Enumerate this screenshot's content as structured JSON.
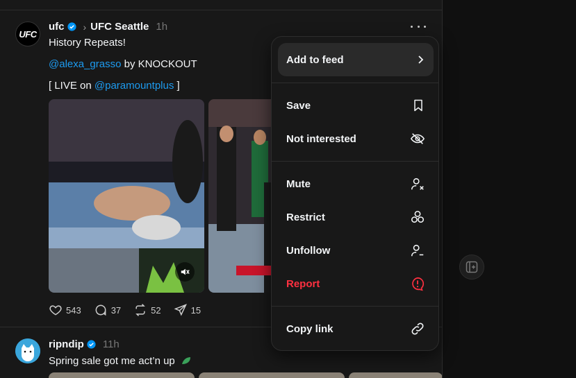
{
  "post1": {
    "avatar_text": "UFC",
    "username": "ufc",
    "community": "UFC Seattle",
    "time": "1h",
    "line1": "History Repeats!",
    "mention1": "@alexa_grasso",
    "line2_rest": " by KNOCKOUT",
    "line3_start": "[ LIVE on ",
    "mention2": "@paramountplus",
    "line3_end": " ]",
    "likes": "543",
    "comments": "37",
    "reposts": "52",
    "shares": "15"
  },
  "post2": {
    "username": "ripndip",
    "time": "11h",
    "text": "Spring sale got me act’n up"
  },
  "menu": {
    "add_to_feed": "Add to feed",
    "save": "Save",
    "not_interested": "Not interested",
    "mute": "Mute",
    "restrict": "Restrict",
    "unfollow": "Unfollow",
    "report": "Report",
    "copy_link": "Copy link"
  },
  "colors": {
    "mention": "#1d9bf0",
    "danger": "#ff3040",
    "verified": "#0095f6"
  },
  "icons": [
    "more-icon",
    "chevron-right-icon",
    "bookmark-icon",
    "eye-off-icon",
    "user-x-icon",
    "restrict-icon",
    "user-minus-icon",
    "alert-icon",
    "link-icon",
    "heart-icon",
    "comment-icon",
    "repost-icon",
    "share-icon",
    "mute-icon",
    "add-column-icon"
  ]
}
